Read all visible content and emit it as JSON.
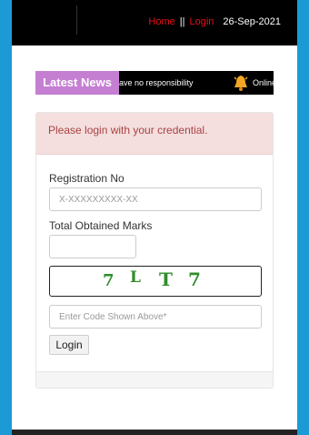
{
  "header": {
    "nav_home": "Home",
    "nav_separator": "||",
    "nav_login": "Login",
    "date": "26-Sep-2021"
  },
  "news": {
    "badge": "Latest News",
    "ticker_text_1": "ave no responsibility",
    "ticker_icon": "bell-icon",
    "ticker_text_2": "Online"
  },
  "login_panel": {
    "alert": "Please login with your credential.",
    "registration_label": "Registration No",
    "registration_placeholder": "X-XXXXXXXXX-XX",
    "registration_value": "",
    "marks_label": "Total Obtained Marks",
    "marks_value": "",
    "captcha_chars": [
      "7",
      "L",
      "T",
      "7"
    ],
    "captcha_color": "#2f8e2b",
    "code_placeholder": "Enter Code Shown Above*",
    "code_value": "",
    "login_button": "Login"
  },
  "colors": {
    "background": "#1c9ad6",
    "header_bg": "#000000",
    "nav_link": "#e8101b",
    "badge_bg": "#c57fd2",
    "alert_bg": "#f4dede",
    "alert_text": "#a94442"
  }
}
